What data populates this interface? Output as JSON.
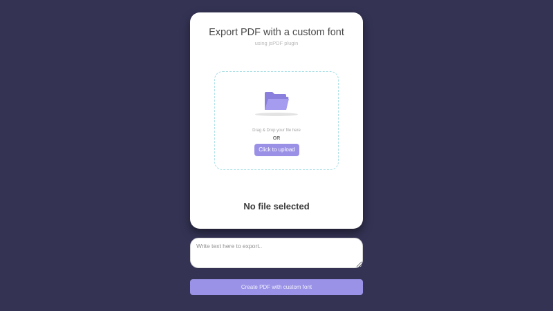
{
  "card": {
    "title": "Export PDF with a custom font",
    "subtitle": "using jsPDF plugin",
    "dropzone": {
      "icon": "folder-open-icon",
      "drag_text": "Drag & Drop your file here",
      "or_text": "OR",
      "upload_label": "Click to upload"
    },
    "status": "No file selected"
  },
  "editor": {
    "placeholder": "Write text here to export.."
  },
  "actions": {
    "create_label": "Create PDF with custom font"
  },
  "colors": {
    "background": "#343354",
    "card": "#ffffff",
    "accent": "#9a90e6",
    "dropzone_border": "#a8dfe6"
  }
}
